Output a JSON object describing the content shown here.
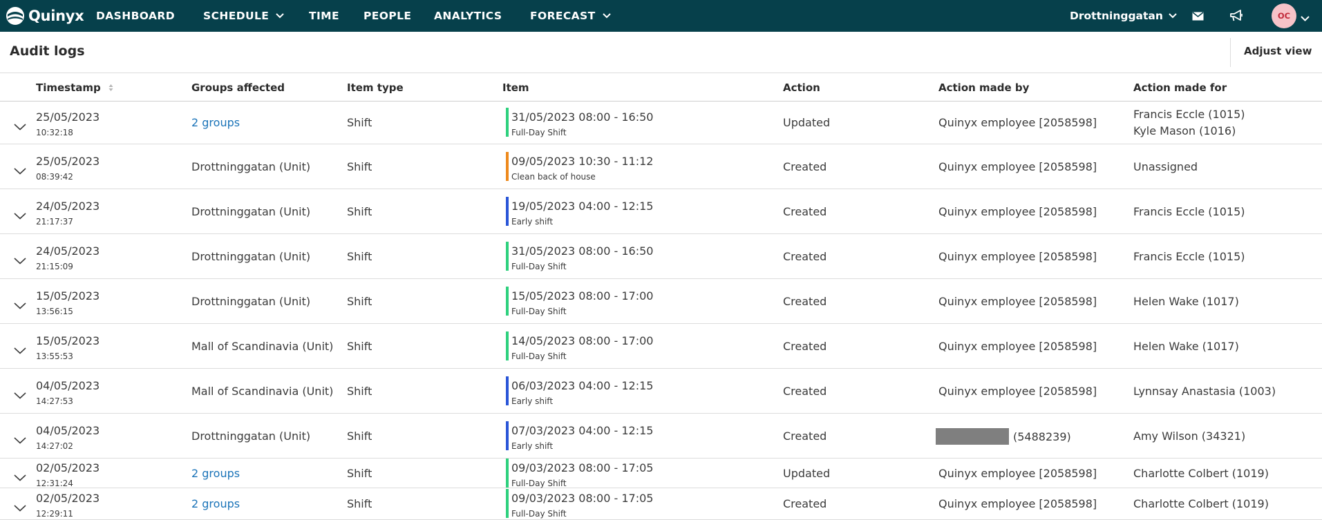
{
  "nav": {
    "brand": "Quinyx",
    "items": [
      {
        "label": "DASHBOARD",
        "dropdown": false
      },
      {
        "label": "SCHEDULE",
        "dropdown": true
      },
      {
        "label": "TIME",
        "dropdown": false
      },
      {
        "label": "PEOPLE",
        "dropdown": false
      },
      {
        "label": "ANALYTICS",
        "dropdown": false
      },
      {
        "label": "FORECAST",
        "dropdown": true
      }
    ],
    "location": "Drottninggatan",
    "avatar_initials": "OC",
    "icons": [
      "mail-icon",
      "megaphone-icon",
      "chevron-down-icon"
    ]
  },
  "page": {
    "title": "Audit logs",
    "adjust_view": "Adjust view"
  },
  "table": {
    "columns": [
      "Timestamp",
      "Groups affected",
      "Item type",
      "Item",
      "Action",
      "Action made by",
      "Action made for"
    ],
    "rows": [
      {
        "date": "25/05/2023",
        "time": "10:32:18",
        "groups": "2 groups",
        "groups_link": true,
        "type": "Shift",
        "item": "31/05/2023 08:00 - 16:50",
        "item_sub": "Full-Day Shift",
        "color": "#2ed17e",
        "action": "Updated",
        "by": "Quinyx employee [2058598]",
        "for": [
          "Francis Eccle (1015)",
          "Kyle Mason (1016)"
        ]
      },
      {
        "date": "25/05/2023",
        "time": "08:39:42",
        "groups": "Drottninggatan (Unit)",
        "groups_link": false,
        "type": "Shift",
        "item": "09/05/2023 10:30 - 11:12",
        "item_sub": "Clean back of house",
        "color": "#ee8a1d",
        "action": "Created",
        "by": "Quinyx employee [2058598]",
        "for": [
          "Unassigned"
        ]
      },
      {
        "date": "24/05/2023",
        "time": "21:17:37",
        "groups": "Drottninggatan (Unit)",
        "groups_link": false,
        "type": "Shift",
        "item": "19/05/2023 04:00 - 12:15",
        "item_sub": "Early shift",
        "color": "#2a56d8",
        "action": "Created",
        "by": "Quinyx employee [2058598]",
        "for": [
          "Francis Eccle (1015)"
        ]
      },
      {
        "date": "24/05/2023",
        "time": "21:15:09",
        "groups": "Drottninggatan (Unit)",
        "groups_link": false,
        "type": "Shift",
        "item": "31/05/2023 08:00 - 16:50",
        "item_sub": "Full-Day Shift",
        "color": "#2ed17e",
        "action": "Created",
        "by": "Quinyx employee [2058598]",
        "for": [
          "Francis Eccle (1015)"
        ]
      },
      {
        "date": "15/05/2023",
        "time": "13:56:15",
        "groups": "Drottninggatan (Unit)",
        "groups_link": false,
        "type": "Shift",
        "item": "15/05/2023 08:00 - 17:00",
        "item_sub": "Full-Day Shift",
        "color": "#2ed17e",
        "action": "Created",
        "by": "Quinyx employee [2058598]",
        "for": [
          "Helen Wake (1017)"
        ]
      },
      {
        "date": "15/05/2023",
        "time": "13:55:53",
        "groups": "Mall of Scandinavia (Unit)",
        "groups_link": false,
        "type": "Shift",
        "item": "14/05/2023 08:00 - 17:00",
        "item_sub": "Full-Day Shift",
        "color": "#2ed17e",
        "action": "Created",
        "by": "Quinyx employee [2058598]",
        "for": [
          "Helen Wake (1017)"
        ]
      },
      {
        "date": "04/05/2023",
        "time": "14:27:53",
        "groups": "Mall of Scandinavia (Unit)",
        "groups_link": false,
        "type": "Shift",
        "item": "06/03/2023 04:00 - 12:15",
        "item_sub": "Early shift",
        "color": "#2a56d8",
        "action": "Created",
        "by": "Quinyx employee [2058598]",
        "for": [
          "Lynnsay Anastasia (1003)"
        ]
      },
      {
        "date": "04/05/2023",
        "time": "14:27:02",
        "groups": "Drottninggatan (Unit)",
        "groups_link": false,
        "type": "Shift",
        "item": "07/03/2023 04:00 - 12:15",
        "item_sub": "Early shift",
        "color": "#2a56d8",
        "action": "Created",
        "by": "(5488239)",
        "by_redacted": true,
        "for": [
          "Amy Wilson (34321)"
        ]
      },
      {
        "date": "02/05/2023",
        "time": "12:31:24",
        "groups": "2 groups",
        "groups_link": true,
        "type": "Shift",
        "item": "09/03/2023 08:00 - 17:05",
        "item_sub": "Full-Day Shift",
        "color": "#2ed17e",
        "action": "Updated",
        "by": "Quinyx employee [2058598]",
        "for": [
          "Charlotte Colbert (1019)"
        ]
      },
      {
        "date": "02/05/2023",
        "time": "12:29:11",
        "groups": "2 groups",
        "groups_link": true,
        "type": "Shift",
        "item": "09/03/2023 08:00 - 17:05",
        "item_sub": "Full-Day Shift",
        "color": "#2ed17e",
        "action": "Created",
        "by": "Quinyx employee [2058598]",
        "for": [
          "Charlotte Colbert (1019)"
        ]
      }
    ]
  }
}
